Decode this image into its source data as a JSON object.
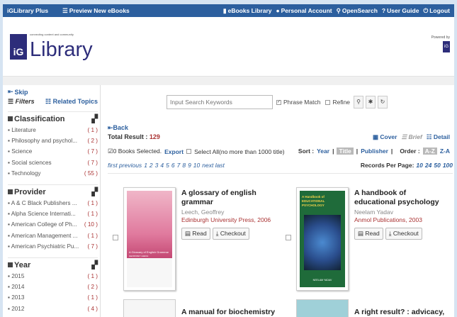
{
  "topbar": {
    "brand": "iGLibrary Plus",
    "preview": "Preview New eBooks",
    "links": [
      "eBooks Library",
      "Personal Account",
      "OpenSearch",
      "User Guide",
      "Logout"
    ]
  },
  "logo": {
    "tagline": "connecting content and community",
    "letters": "iG",
    "word": "Library"
  },
  "powered": {
    "label": "Powered by",
    "mark": "iG"
  },
  "sidebar": {
    "skip": "Skip",
    "filters": "Filters",
    "related": "Related Topics",
    "sections": [
      {
        "title": "Classification",
        "items": [
          {
            "label": "Literature",
            "count": "( 1 )"
          },
          {
            "label": "Philosophy and psychol...",
            "count": "( 2 )"
          },
          {
            "label": "Science",
            "count": "( 7 )"
          },
          {
            "label": "Social sciences",
            "count": "( 7 )"
          },
          {
            "label": "Technology",
            "count": "( 55 )"
          }
        ]
      },
      {
        "title": "Provider",
        "items": [
          {
            "label": "A & C Black Publishers ...",
            "count": "( 1 )"
          },
          {
            "label": "Alpha Science Internati...",
            "count": "( 1 )"
          },
          {
            "label": "American College of Ph...",
            "count": "( 10 )"
          },
          {
            "label": "American Management ...",
            "count": "( 1 )"
          },
          {
            "label": "American Psychiatric Pu...",
            "count": "( 7 )"
          }
        ]
      },
      {
        "title": "Year",
        "items": [
          {
            "label": "2015",
            "count": "( 1 )"
          },
          {
            "label": "2014",
            "count": "( 2 )"
          },
          {
            "label": "2013",
            "count": "( 1 )"
          },
          {
            "label": "2012",
            "count": "( 4 )"
          }
        ]
      }
    ]
  },
  "search": {
    "placeholder": "Input Search Keywords",
    "phrase": "Phrase Match",
    "refine": "Refine"
  },
  "results": {
    "back": "Back",
    "total_label": "Total Result : ",
    "total": "129",
    "views": [
      "Cover",
      "Brief",
      "Detail"
    ],
    "selected": "0 Books Selected.",
    "export": "Export",
    "select_all": "Select All(no more than 1000 title)",
    "sort_label": "Sort :",
    "sort": [
      "Year",
      "Title",
      "Publisher"
    ],
    "order_label": "Order :",
    "order": [
      "A-Z",
      "Z-A"
    ],
    "pager_prev": "first previous",
    "pages": [
      "1",
      "2",
      "3",
      "4",
      "5",
      "6",
      "7",
      "8",
      "9",
      "10"
    ],
    "pager_next": "next last",
    "perpage_label": "Records Per Page:",
    "perpage": [
      "10",
      "24",
      "50",
      "100"
    ]
  },
  "books": [
    {
      "title": "A glossary of english grammar",
      "author": "Leech, Geoffrey",
      "publisher": "Edinburgh University Press, 2006",
      "cover_title": "A Glossary of English Grammar",
      "cover_author": "GEOFFREY LEECH"
    },
    {
      "title": "A handbook of educational psychology",
      "author": "Neelam Yadav",
      "publisher": "Anmol Publications, 2003",
      "cover_title": "A Handbook of EDUCATIONAL PSYCHOLOGY",
      "cover_author": "NEELAM YADAV"
    },
    {
      "title": "A manual for biochemistry"
    },
    {
      "title": "A right result? : advicacy,"
    }
  ],
  "buttons": {
    "read": "Read",
    "checkout": "Checkout"
  },
  "colors": {
    "topbar": "#2c5f9e",
    "link": "#2c5f9e",
    "count": "#aa3333",
    "logo": "#2d2d7a"
  }
}
